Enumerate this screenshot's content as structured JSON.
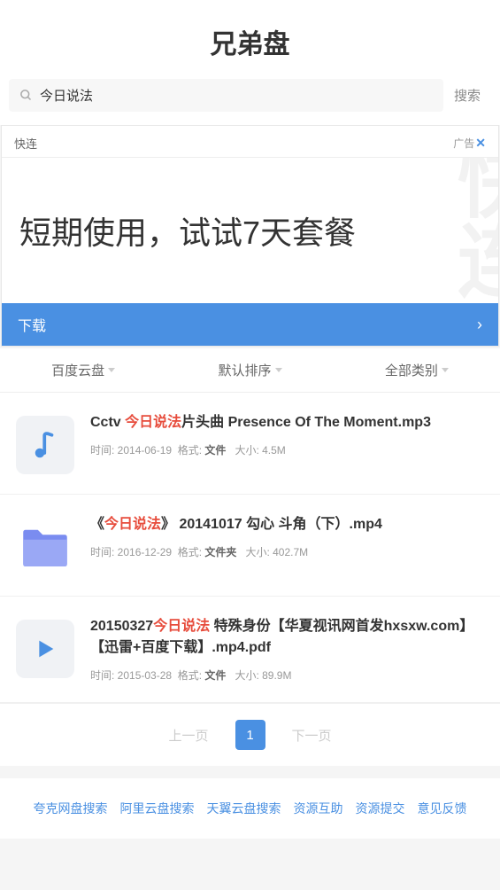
{
  "site_title": "兄弟盘",
  "search": {
    "value": "今日说法",
    "button": "搜索"
  },
  "ad": {
    "top_left": "快连",
    "tag": "广告",
    "close": "✕",
    "main_text": "短期使用，试试7天套餐",
    "bottom_label": "下载"
  },
  "filters": [
    {
      "label": "百度云盘"
    },
    {
      "label": "默认排序"
    },
    {
      "label": "全部类别"
    }
  ],
  "results": [
    {
      "icon_type": "music",
      "title_parts": {
        "pre": "Cctv ",
        "hl": "今日说法",
        "post": "片头曲 Presence Of The Moment.mp3"
      },
      "meta": {
        "time_label": "时间: ",
        "time": "2014-06-19",
        "format_label": "格式: ",
        "format": "文件",
        "size_label": "大小: ",
        "size": "4.5M"
      }
    },
    {
      "icon_type": "folder",
      "title_parts": {
        "pre": "《",
        "hl": "今日说法",
        "post": "》 20141017 勾心 斗角（下）.mp4"
      },
      "meta": {
        "time_label": "时间: ",
        "time": "2016-12-29",
        "format_label": "格式: ",
        "format": "文件夹",
        "size_label": "大小: ",
        "size": "402.7M"
      }
    },
    {
      "icon_type": "video",
      "title_parts": {
        "pre": "20150327",
        "hl": "今日说法",
        "post": " 特殊身份【华夏视讯网首发hxsxw.com】【迅雷+百度下载】.mp4.pdf"
      },
      "meta": {
        "time_label": "时间: ",
        "time": "2015-03-28",
        "format_label": "格式: ",
        "format": "文件",
        "size_label": "大小: ",
        "size": "89.9M"
      }
    }
  ],
  "pagination": {
    "prev": "上一页",
    "current": "1",
    "next": "下一页"
  },
  "footer": [
    "夸克网盘搜索",
    "阿里云盘搜索",
    "天翼云盘搜索",
    "资源互助",
    "资源提交",
    "意见反馈"
  ]
}
